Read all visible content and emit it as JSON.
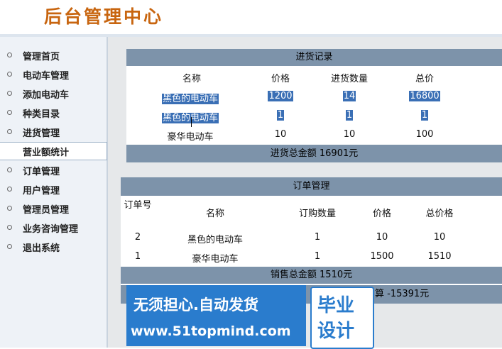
{
  "header": {
    "title": "后台管理中心"
  },
  "nav": {
    "items": [
      {
        "label": "管理首页"
      },
      {
        "label": "电动车管理"
      },
      {
        "label": "添加电动车"
      },
      {
        "label": "种类目录"
      },
      {
        "label": "进货管理"
      },
      {
        "label": "营业额统计"
      },
      {
        "label": "订单管理"
      },
      {
        "label": "用户管理"
      },
      {
        "label": "管理员管理"
      },
      {
        "label": "业务咨询管理"
      },
      {
        "label": "退出系统"
      }
    ],
    "active_index": 5
  },
  "purchase": {
    "title": "进货记录",
    "headers": [
      "名称",
      "价格",
      "进货数量",
      "总价"
    ],
    "rows": [
      [
        "黑色的电动车",
        "1200",
        "14",
        "16800"
      ],
      [
        "黑色的电动车",
        "1",
        "1",
        "1"
      ],
      [
        "豪华电动车",
        "10",
        "10",
        "100"
      ]
    ],
    "total_label": "进货总金额 16901元"
  },
  "orders": {
    "title": "订单管理",
    "headers": [
      "订单号",
      "名称",
      "订购数量",
      "价格",
      "总价格"
    ],
    "rows": [
      [
        "2",
        "黑色的电动车",
        "1",
        "10",
        "10"
      ],
      [
        "1",
        "豪华电动车",
        "1",
        "1500",
        "1510"
      ]
    ],
    "total_label": "销售总金额 1510元",
    "profit_label": "算 -15391元"
  },
  "watermark": {
    "line1": "无须担心.自动发货",
    "line2": "www.51topmind.com",
    "badge1": "毕业",
    "badge2": "设计"
  },
  "colors": {
    "title": "#c8650f",
    "bar": "#7d93aa",
    "selection": "#3a6fb5",
    "watermark": "#2a7ccd"
  }
}
